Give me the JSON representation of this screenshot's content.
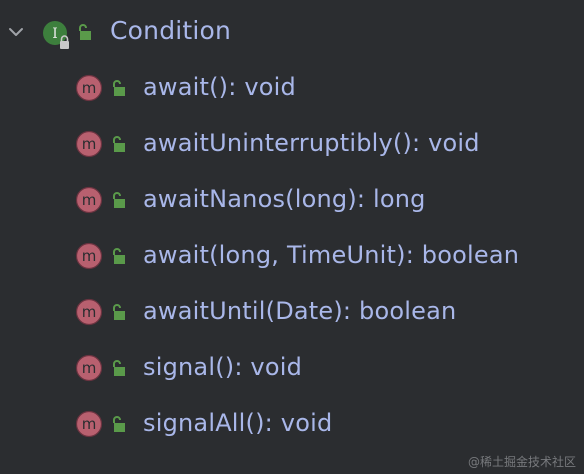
{
  "tree": {
    "root": {
      "label": "Condition",
      "icon": "interface-icon",
      "icon_letter": "I",
      "expanded": true
    },
    "methods": [
      {
        "label": "await(): void"
      },
      {
        "label": "awaitUninterruptibly(): void"
      },
      {
        "label": "awaitNanos(long): long"
      },
      {
        "label": "await(long, TimeUnit): boolean"
      },
      {
        "label": "awaitUntil(Date): boolean"
      },
      {
        "label": "signal(): void"
      },
      {
        "label": "signalAll(): void"
      }
    ],
    "method_icon_letter": "m"
  },
  "watermark": "@稀土掘金技术社区",
  "colors": {
    "background": "#2b2d30",
    "label": "#a9b7e9",
    "interface_green": "#3d8b3d",
    "method_pink": "#c36a7d",
    "lock_green": "#5a9a4a"
  }
}
